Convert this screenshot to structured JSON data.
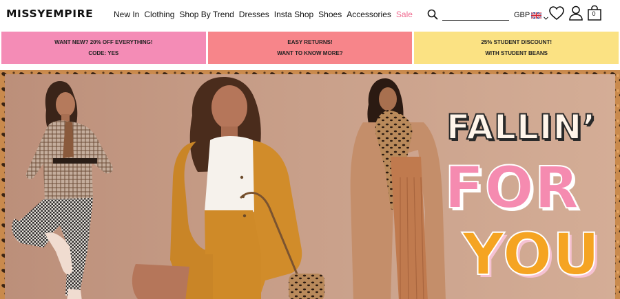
{
  "brand": {
    "logo_text": "MISSYEMPIRE"
  },
  "nav": {
    "items": [
      {
        "label": "New In"
      },
      {
        "label": "Clothing"
      },
      {
        "label": "Shop By Trend"
      },
      {
        "label": "Dresses"
      },
      {
        "label": "Insta Shop"
      },
      {
        "label": "Shoes"
      },
      {
        "label": "Accessories"
      },
      {
        "label": "Sale"
      }
    ]
  },
  "search": {
    "placeholder": "",
    "value": ""
  },
  "currency": {
    "label": "GBP",
    "flag_icon": "uk-flag-icon"
  },
  "icons": {
    "search": "search-icon",
    "wishlist": "heart-icon",
    "account": "user-icon",
    "bag": "shopping-bag-icon"
  },
  "bag": {
    "count": "0"
  },
  "promos": [
    {
      "line1": "WANT NEW? 20% OFF EVERYTHING!",
      "line2": "CODE: YES",
      "color": "#f48cb6"
    },
    {
      "line1": "EASY RETURNS!",
      "line2": "WANT TO KNOW MORE?",
      "color": "#f7858a"
    },
    {
      "line1": "25% STUDENT DISCOUNT!",
      "line2": "WITH STUDENT BEANS",
      "color": "#fbe283"
    }
  ],
  "hero": {
    "headline_1": "FALLIN’",
    "headline_2": "FOR",
    "headline_3": "YOU",
    "colors": {
      "pink": "#f58bb0",
      "orange": "#f5a422",
      "background": "#c9a08a"
    }
  },
  "colors": {
    "sale": "#f06a8f"
  }
}
